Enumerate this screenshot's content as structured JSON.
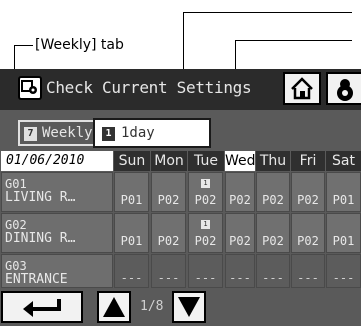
{
  "callouts": {
    "weekly_tab": "[Weekly] tab",
    "right_top": "",
    "right_bottom": ""
  },
  "window": {
    "title": "Check Current Settings",
    "icons": {
      "title": "check-settings-icon",
      "home": "home-icon",
      "settings": "settings-icon"
    }
  },
  "tabs": [
    {
      "label": "Weekly",
      "icon": "weekly-tab-icon",
      "selected": true
    },
    {
      "label": "1day",
      "icon": "day-tab-icon",
      "selected": false
    }
  ],
  "schedule": {
    "date": "01/06/2010",
    "days": [
      "Sun",
      "Mon",
      "Tue",
      "Wed",
      "Thu",
      "Fri",
      "Sat"
    ],
    "selected_day": "Wed",
    "rows": [
      {
        "zone_id": "G01",
        "zone_name": "LIVING R…",
        "cells": [
          "P01",
          "P02",
          "P02",
          "P02",
          "P02",
          "P02",
          "P01"
        ],
        "marked_day": "Tue"
      },
      {
        "zone_id": "G02",
        "zone_name": "DINING R…",
        "cells": [
          "P01",
          "P02",
          "P02",
          "P02",
          "P02",
          "P02",
          "P01"
        ],
        "marked_day": "Tue"
      },
      {
        "zone_id": "G03",
        "zone_name": "ENTRANCE",
        "cells": [
          "---",
          "---",
          "---",
          "---",
          "---",
          "---",
          "---"
        ],
        "marked_day": ""
      }
    ]
  },
  "nav": {
    "page_indicator": "1/8",
    "icons": [
      "return-arrow-icon",
      "up-arrow-icon",
      "down-arrow-icon"
    ]
  },
  "colors": {
    "screen_bg": "#5a5a5a",
    "titlebar_bg": "#2b2b2b",
    "button_bg": "#f2f2f2",
    "header_bg": "#2f2f2f"
  }
}
